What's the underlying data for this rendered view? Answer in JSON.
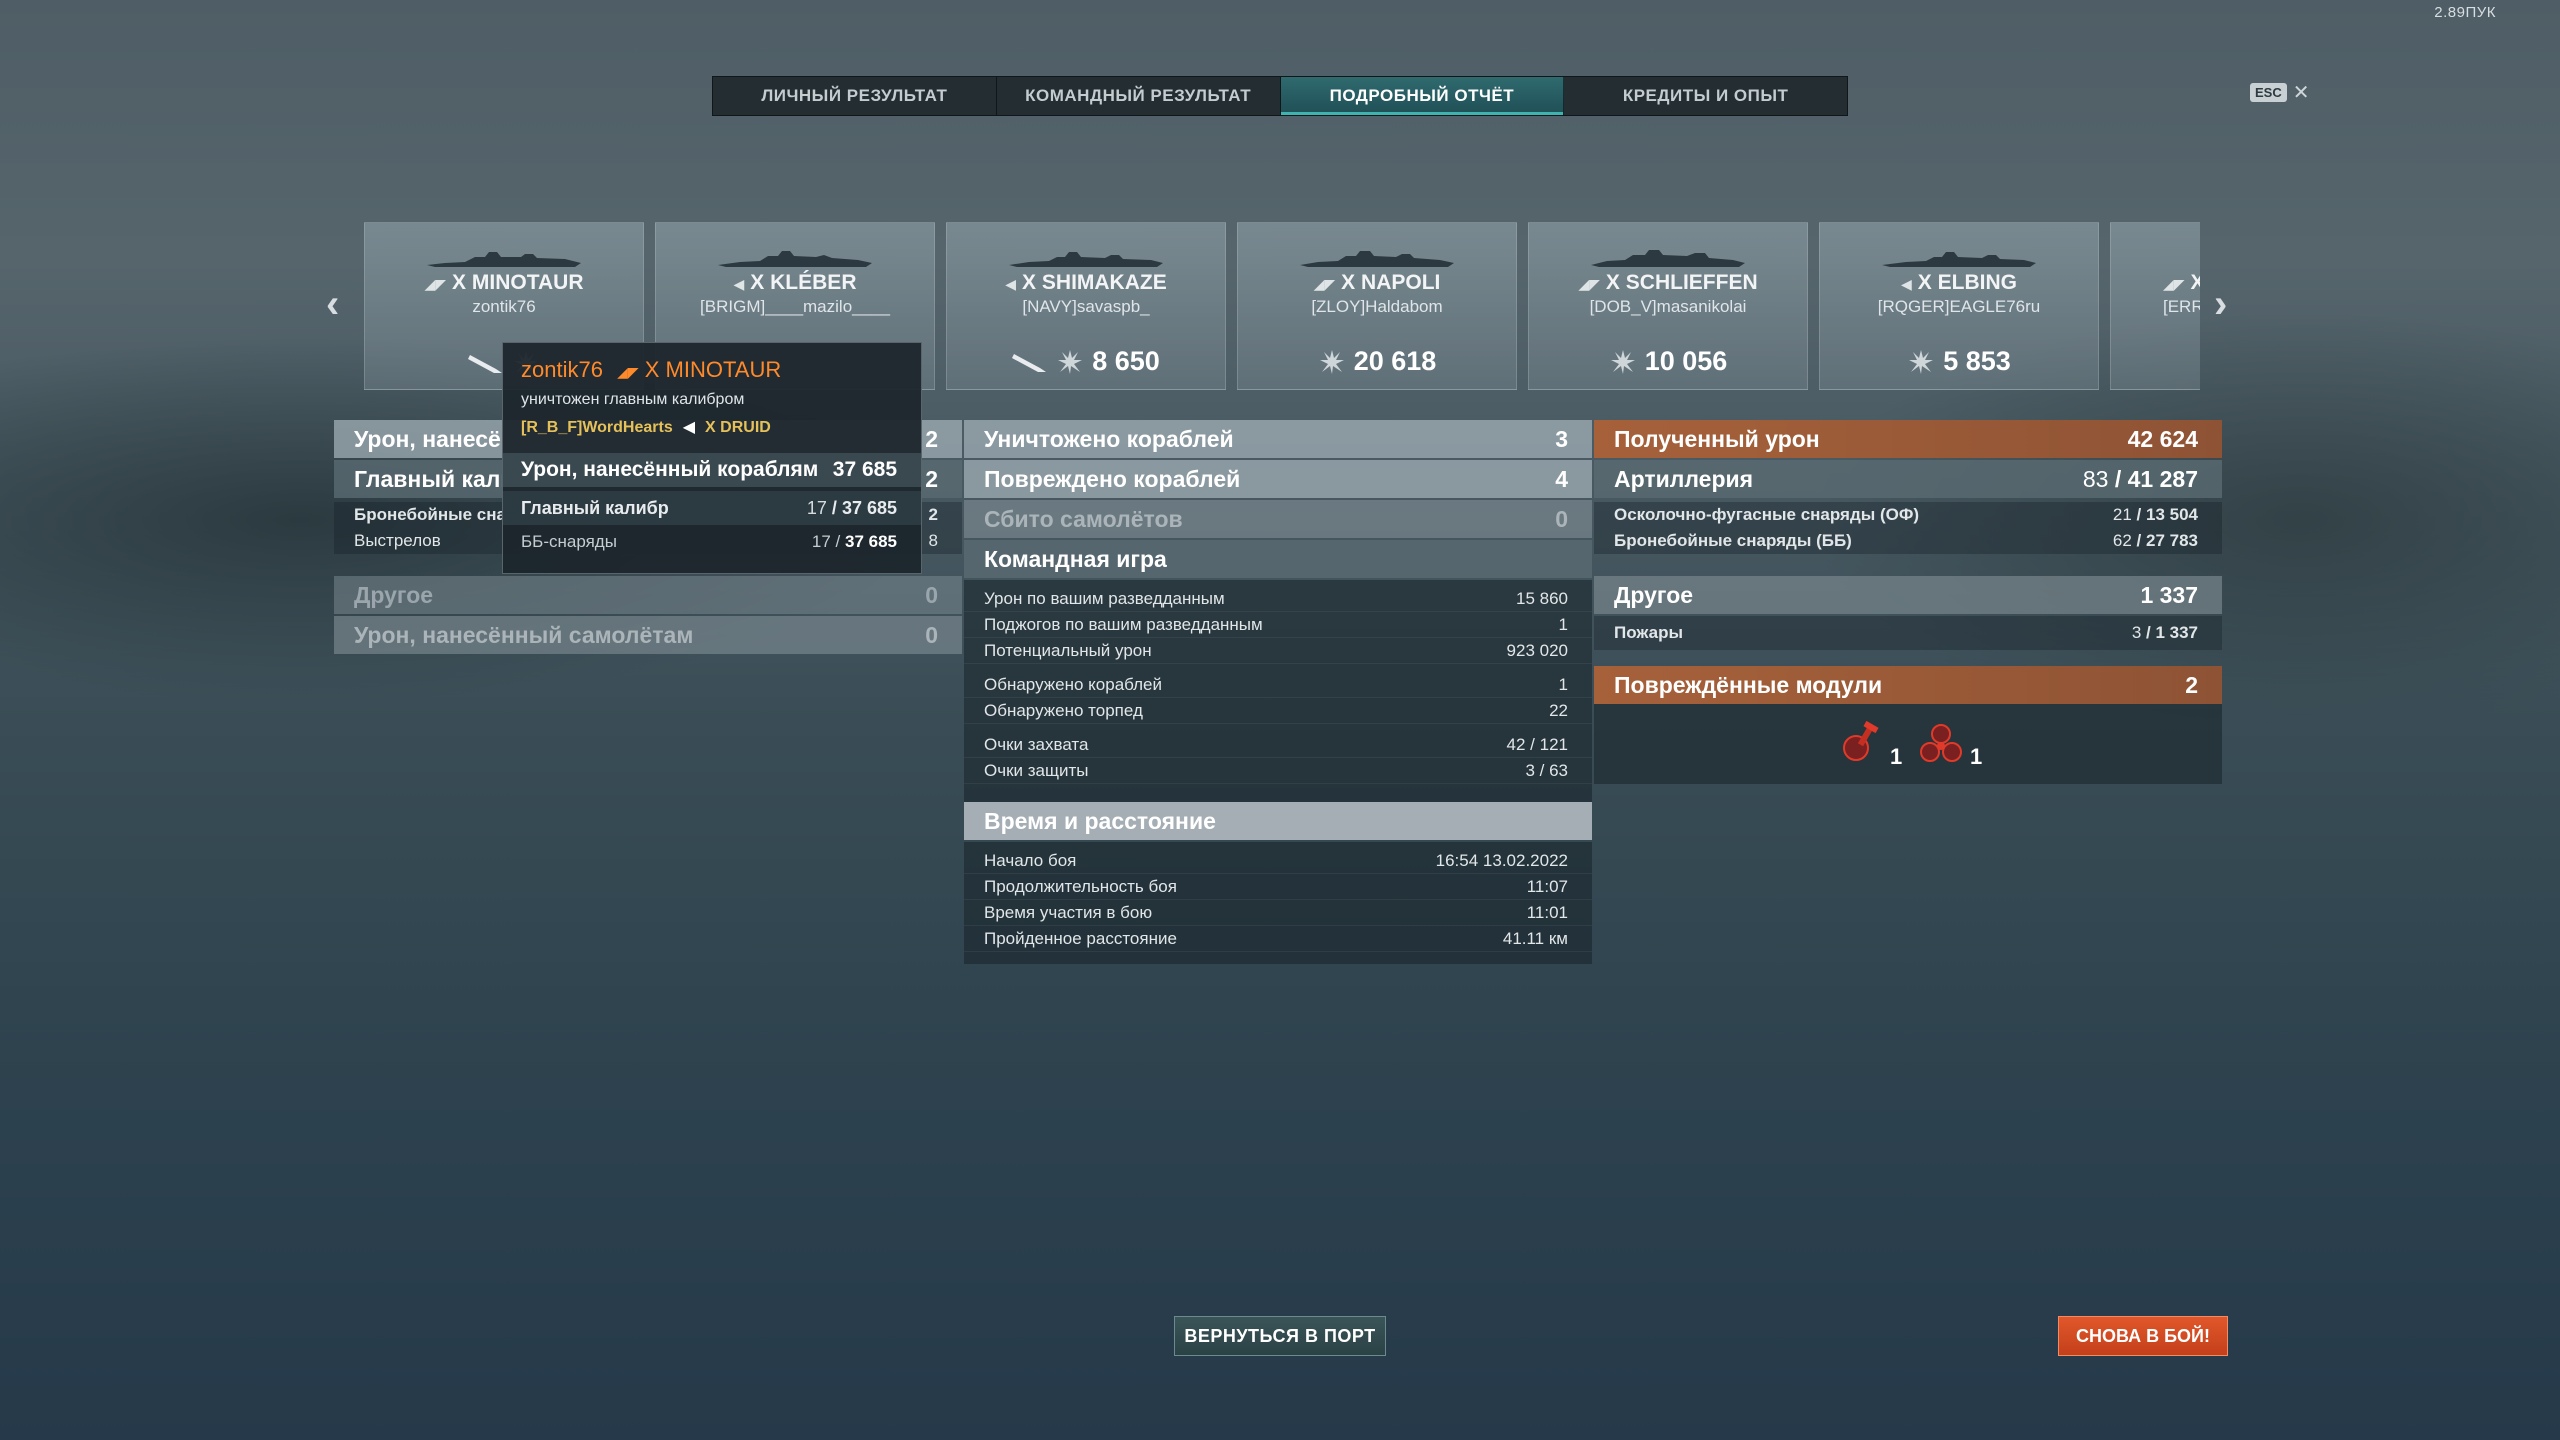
{
  "fps_label": "2.89ПУК",
  "esc_key": "ESC",
  "tabs": [
    "ЛИЧНЫЙ РЕЗУЛЬТАТ",
    "КОМАНДНЫЙ РЕЗУЛЬТАТ",
    "ПОДРОБНЫЙ ОТЧЁТ",
    "КРЕДИТЫ И ОПЫТ"
  ],
  "active_tab": "ПОДРОБНЫЙ ОТЧЁТ",
  "ships": [
    {
      "tier": "X",
      "name": "MINOTAUR",
      "player": "zontik76",
      "damage": ""
    },
    {
      "tier": "X",
      "name": "KLÉBER",
      "player": "[BRIGM]____mazilo____",
      "damage": ""
    },
    {
      "tier": "X",
      "name": "SHIMAKAZE",
      "player": "[NAVY]savaspb_",
      "damage": "8 650"
    },
    {
      "tier": "X",
      "name": "NAPOLI",
      "player": "[ZLOY]Haldabom",
      "damage": "20 618"
    },
    {
      "tier": "X",
      "name": "SCHLIEFFEN",
      "player": "[DOB_V]masanikolai",
      "damage": "10 056"
    },
    {
      "tier": "X",
      "name": "ELBING",
      "player": "[RQGER]EAGLE76ru",
      "damage": "5 853"
    },
    {
      "tier": "X",
      "name": "",
      "player": "[ERR",
      "damage": ""
    }
  ],
  "tooltip": {
    "player": "zontik76",
    "ship": "X MINOTAUR",
    "status": "уничтожен главным калибром",
    "killer": "[R_B_F]WordHearts",
    "killer_ship": "X DRUID",
    "damage_label": "Урон, нанесённый кораблям",
    "damage_value": "37 685",
    "main_label": "Главный калибр",
    "main_hits": "17",
    "main_value": "37 685",
    "ap_label": "ББ-снаряды",
    "ap_hits": "17",
    "ap_value": "37 685"
  },
  "left": {
    "damage_label": "Урон, нанесё",
    "damage_value": "2",
    "main_label": "Главный калиб",
    "main_value": "2",
    "ap_label": "Бронебойные снар",
    "ap_value": "2",
    "shots_label": "Выстрелов",
    "shots_value": "8",
    "other_label": "Другое",
    "other_value": "0",
    "planes_label": "Урон, нанесённый самолётам",
    "planes_value": "0"
  },
  "middle": {
    "destroyed_label": "Уничтожено кораблей",
    "destroyed_value": "3",
    "damaged_label": "Повреждено кораблей",
    "damaged_value": "4",
    "planes_label": "Сбито самолётов",
    "planes_value": "0",
    "team_label": "Командная игра",
    "team_rows": [
      {
        "label": "Урон по вашим разведданным",
        "value": "15 860"
      },
      {
        "label": "Поджогов по вашим разведданным",
        "value": "1"
      },
      {
        "label": "Потенциальный урон",
        "value": "923 020"
      },
      {
        "label": "Обнаружено кораблей",
        "value": "1"
      },
      {
        "label": "Обнаружено торпед",
        "value": "22"
      },
      {
        "label": "Очки захвата",
        "value": "42 / 121"
      },
      {
        "label": "Очки защиты",
        "value": "3 / 63"
      }
    ],
    "time_label": "Время и расстояние",
    "time_rows": [
      {
        "label": "Начало боя",
        "value": "16:54  13.02.2022"
      },
      {
        "label": "Продолжительность боя",
        "value": "11:07"
      },
      {
        "label": "Время участия в бою",
        "value": "11:01"
      },
      {
        "label": "Пройденное расстояние",
        "value": "41.11 км"
      }
    ]
  },
  "right": {
    "received_label": "Полученный урон",
    "received_value": "42 624",
    "art_label": "Артиллерия",
    "art_hits": "83",
    "art_value": "41 287",
    "he_label": "Осколочно-фугасные снаряды (ОФ)",
    "he_hits": "21",
    "he_value": "13 504",
    "ap_label": "Бронебойные снаряды (ББ)",
    "ap_hits": "62",
    "ap_value": "27 783",
    "other_label": "Другое",
    "other_value": "1 337",
    "fires_label": "Пожары",
    "fires_hits": "3",
    "fires_value": "1 337",
    "modules_label": "Повреждённые модули",
    "modules_value": "2",
    "module_counts": [
      "1",
      "1"
    ]
  },
  "buttons": {
    "port": "ВЕРНУТЬСЯ В ПОРТ",
    "battle": "СНОВА В БОЙ!"
  }
}
